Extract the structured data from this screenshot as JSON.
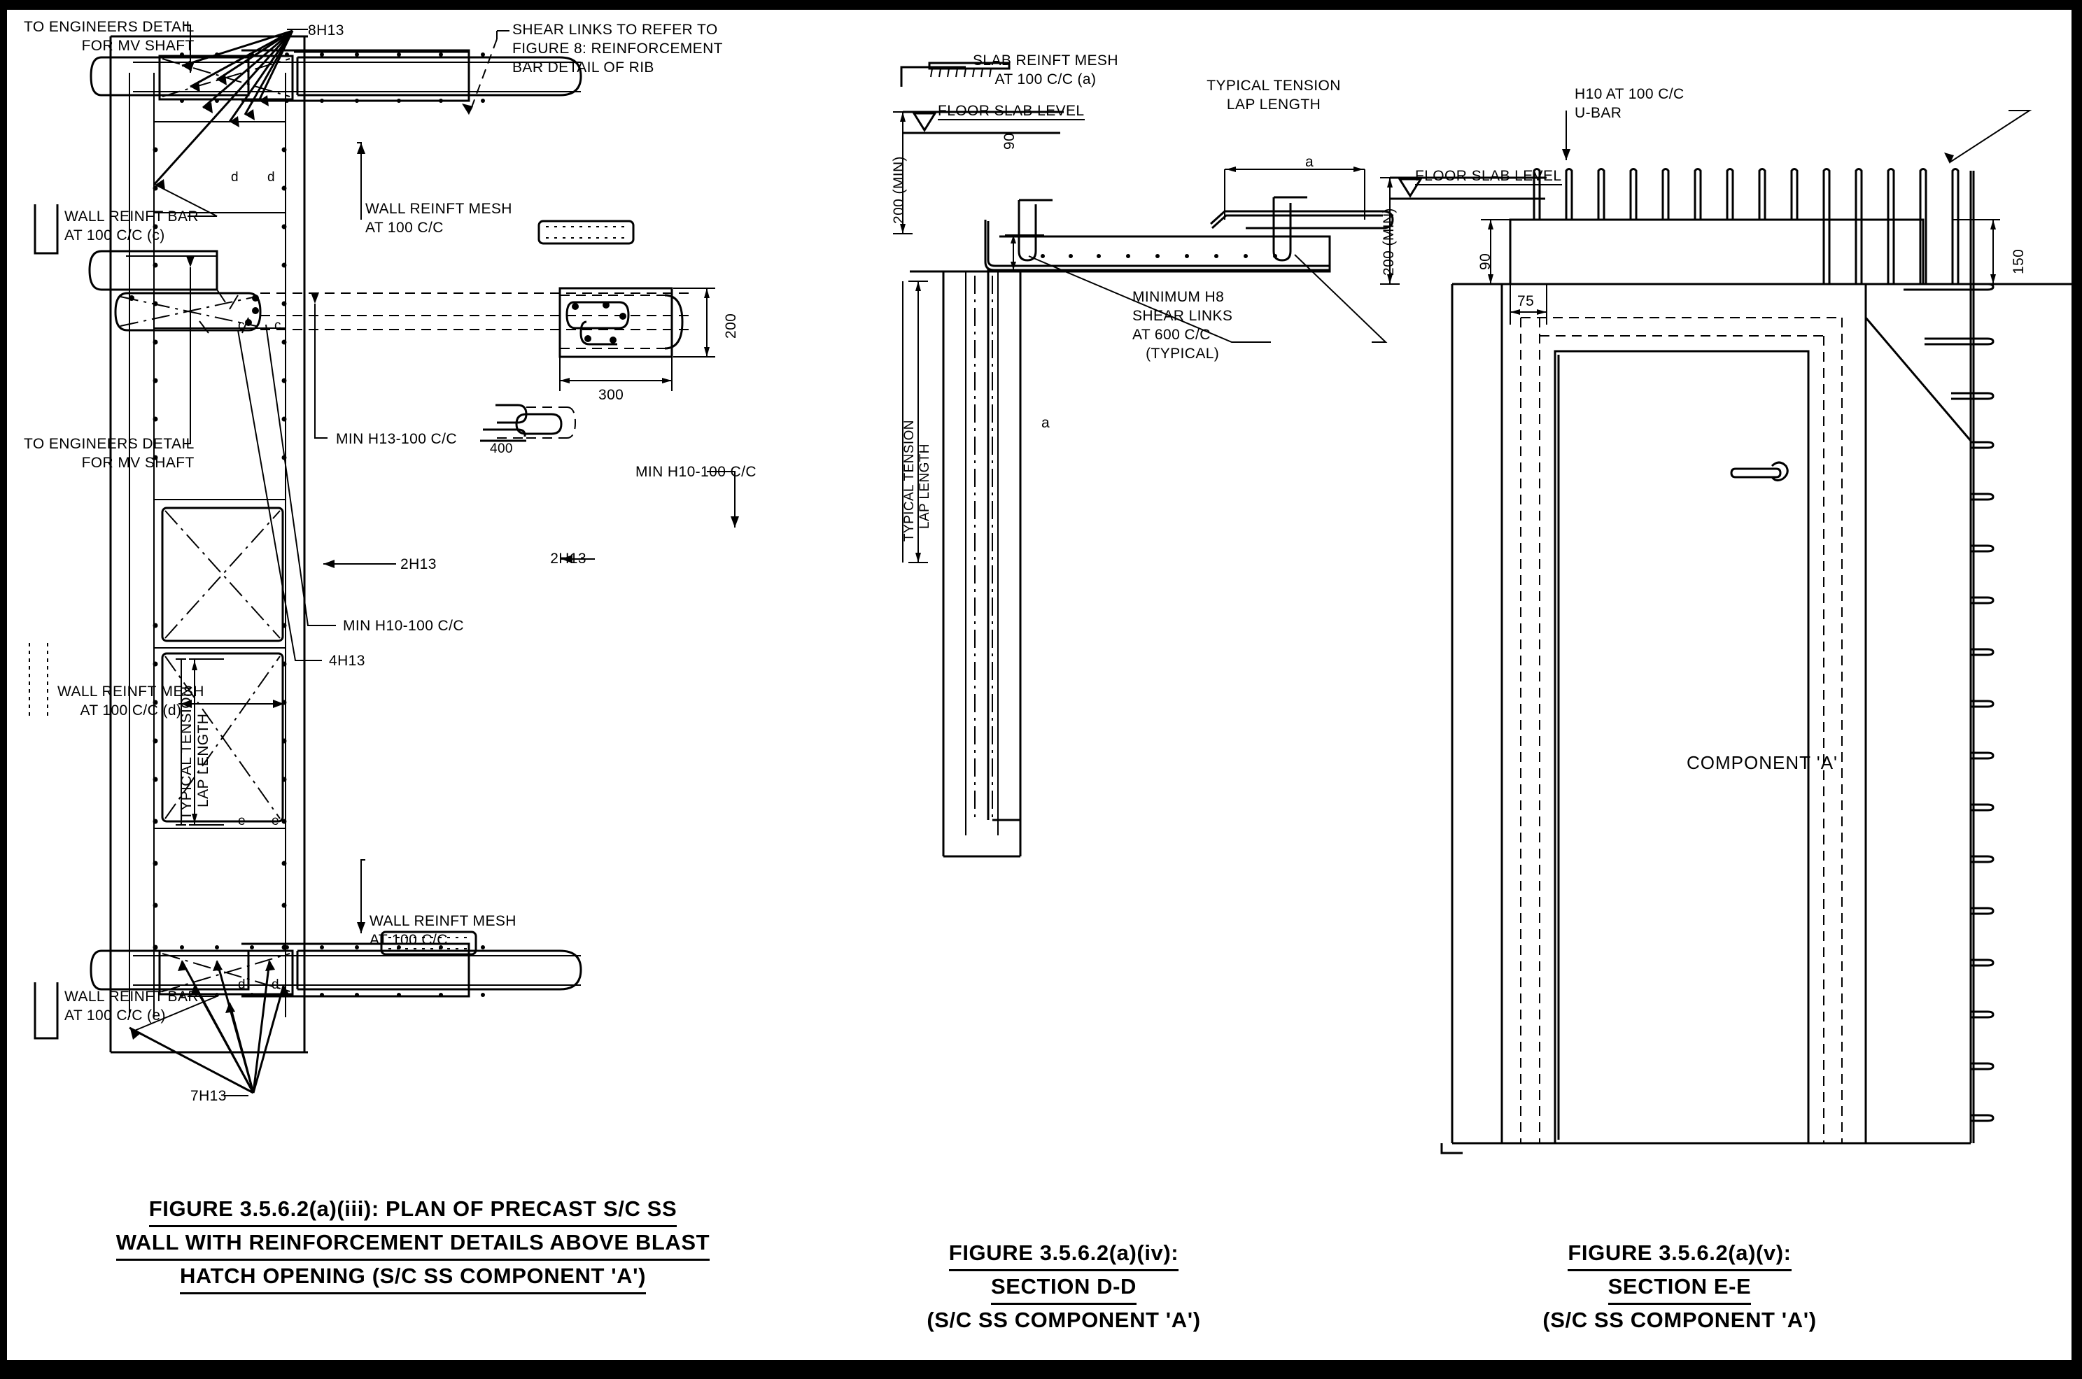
{
  "document": {
    "type": "engineering-reinforcement-drawing",
    "sheet_background": "#000000",
    "paper_background": "#ffffff",
    "line_color": "#000000"
  },
  "figure1": {
    "caption_line1": "FIGURE 3.5.6.2(a)(iii):  PLAN OF PRECAST S/C SS",
    "caption_line2": "WALL WITH REINFORCEMENT DETAILS ABOVE BLAST",
    "caption_line3": "HATCH OPENING (S/C SS COMPONENT 'A')",
    "labels": {
      "mv_shaft_top_l1": "TO ENGINEERS DETAIL",
      "mv_shaft_top_l2": "FOR MV SHAFT",
      "bars_top": "8H13",
      "shear_links_l1": "SHEAR LINKS TO REFER TO",
      "shear_links_l2": "FIGURE 8: REINFORCEMENT",
      "shear_links_l3": "BAR DETAIL OF RIB",
      "wall_bar_c_l1": "WALL REINFT BAR",
      "wall_bar_c_l2": "AT 100 C/C (c)",
      "wall_mesh_top_l1": "WALL REINFT MESH",
      "wall_mesh_top_l2": "AT 100 C/C",
      "mv_shaft_mid_l1": "TO ENGINEERS DETAIL",
      "mv_shaft_mid_l2": "FOR MV SHAFT",
      "min_h13": "MIN H13-100 C/C",
      "dim_400": "400",
      "bars_2h13_left": "2H13",
      "bars_2h13_right": "2H13",
      "min_h10_right": "MIN H10-100 C/C",
      "min_h10_mid": "MIN H10-100 C/C",
      "bars_4h13": "4H13",
      "dim_300": "300",
      "dim_200": "200",
      "wall_mesh_d_l1": "WALL REINFT MESH",
      "wall_mesh_d_l2": "AT 100 C/C (d)",
      "lap_l1": "TYPICAL TENSION",
      "lap_l2": "LAP LENGTH",
      "wall_mesh_bot_l1": "WALL REINFT MESH",
      "wall_mesh_bot_l2": "AT 100 C/C",
      "wall_bar_e_l1": "WALL REINFT BAR",
      "wall_bar_e_l2": "AT 100 C/C (e)",
      "bars_bottom": "7H13",
      "mark_d1": "d",
      "mark_d2": "d",
      "mark_c1": "c",
      "mark_c2": "c",
      "mark_e1": "e",
      "mark_e2": "e",
      "mark_d3": "d",
      "mark_d4": "d"
    }
  },
  "figure2": {
    "caption_line1": "FIGURE 3.5.6.2(a)(iv):",
    "caption_line2": "SECTION D-D",
    "caption_line3": "(S/C SS COMPONENT 'A')",
    "labels": {
      "slab_mesh_l1": "SLAB REINFT MESH",
      "slab_mesh_l2": "AT 100 C/C (a)",
      "lap_top_l1": "TYPICAL TENSION",
      "lap_top_l2": "LAP LENGTH",
      "floor_slab_level": "FLOOR SLAB LEVEL",
      "dim_200_min": "200 (MIN)",
      "dim_90": "90",
      "lap_left_l1": "TYPICAL TENSION",
      "lap_left_l2": "LAP LENGTH",
      "shear_l1": "MINIMUM H8",
      "shear_l2": "SHEAR LINKS",
      "shear_l3": "AT 600 C/C",
      "shear_l4": "(TYPICAL)",
      "mark_a_top": "a",
      "mark_a_bot": "a"
    }
  },
  "figure3": {
    "caption_line1": "FIGURE 3.5.6.2(a)(v):",
    "caption_line2": "SECTION E-E",
    "caption_line3": "(S/C SS COMPONENT 'A')",
    "labels": {
      "floor_slab_level": "FLOOR SLAB LEVEL",
      "dim_200_min": "200 (MIN)",
      "dim_90": "90",
      "dim_75": "75",
      "dim_150": "150",
      "ubar_l1": "H10 AT 100 C/C",
      "ubar_l2": "U-BAR",
      "component_a": "COMPONENT 'A'"
    }
  }
}
